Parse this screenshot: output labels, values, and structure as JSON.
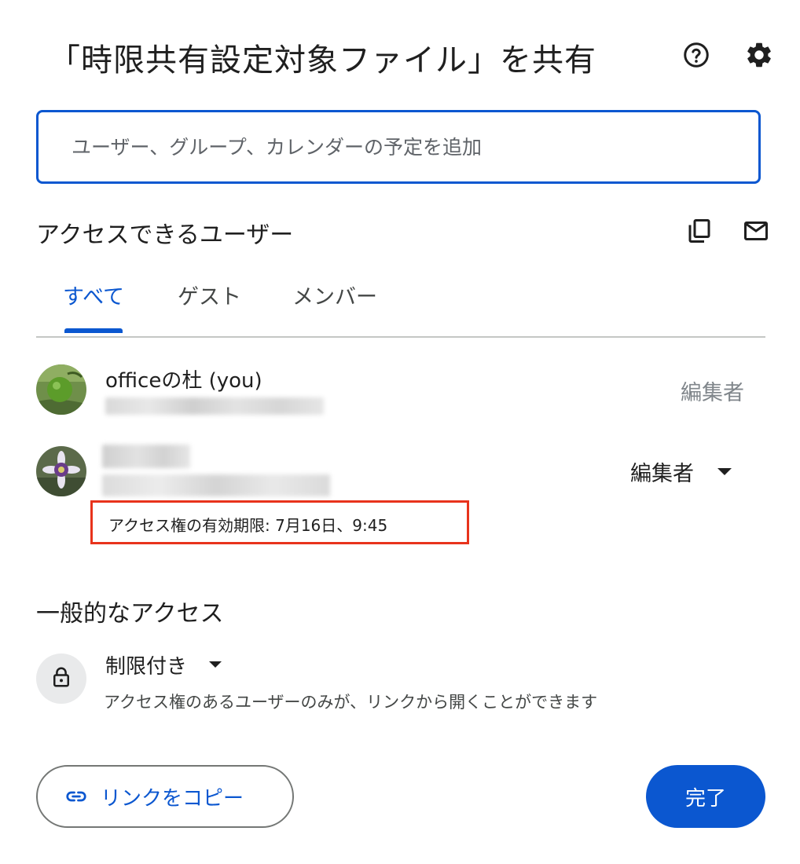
{
  "dialog": {
    "title": "「時限共有設定対象ファイル」を共有",
    "help_icon": "help-circle-icon",
    "settings_icon": "gear-icon"
  },
  "search": {
    "placeholder": "ユーザー、グループ、カレンダーの予定を追加",
    "value": ""
  },
  "access_section": {
    "title": "アクセスできるユーザー",
    "copy_icon": "copy-emails-icon",
    "mail_icon": "email-icon",
    "tabs": [
      {
        "label": "すべて",
        "active": true
      },
      {
        "label": "ゲスト",
        "active": false
      },
      {
        "label": "メンバー",
        "active": false
      }
    ]
  },
  "users": [
    {
      "name": "officeの杜 (you)",
      "role": "編集者"
    },
    {
      "role": "編集者",
      "expiry": "アクセス権の有効期限: 7月16日、9:45"
    }
  ],
  "general_access": {
    "title": "一般的なアクセス",
    "level": "制限付き",
    "description": "アクセス権のあるユーザーのみが、リンクから開くことができます"
  },
  "footer": {
    "copy_link_label": "リンクをコピー",
    "done_label": "完了"
  },
  "colors": {
    "accent": "#0b57d0",
    "highlight_border": "#e8331c"
  }
}
